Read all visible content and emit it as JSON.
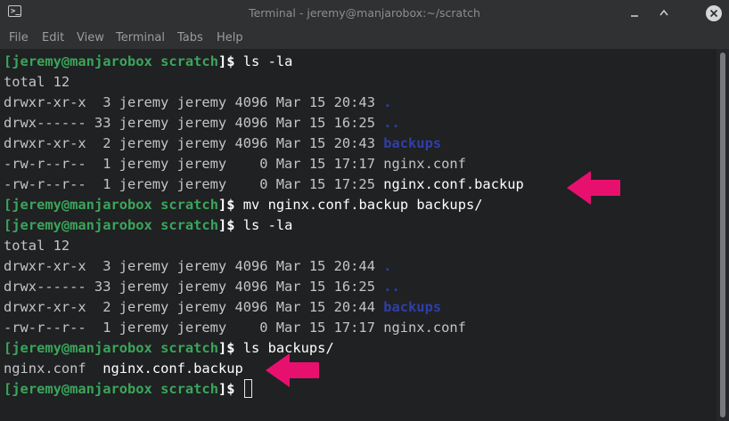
{
  "window": {
    "app_icon": "terminal-icon",
    "title": "Terminal - jeremy@manjarobox:~/scratch",
    "controls": [
      "minimize-icon",
      "maximize-icon",
      "close-icon"
    ]
  },
  "menu": {
    "items": [
      "File",
      "Edit",
      "View",
      "Terminal",
      "Tabs",
      "Help"
    ]
  },
  "prompt": {
    "bracket_open": "[",
    "user_host": "jeremy@manjarobox",
    "dir": "scratch",
    "close": "]$"
  },
  "commands": {
    "ls1": " ls -la",
    "mv": " mv nginx.conf.backup backups/",
    "ls2": " ls -la",
    "ls3": " ls backups/"
  },
  "output": {
    "total1": "total 12",
    "l1_perm": "drwxr-xr-x  3 jeremy jeremy 4096 Mar 15 20:43 ",
    "l1_name": ".",
    "l2_perm": "drwx------ 33 jeremy jeremy 4096 Mar 15 16:25 ",
    "l2_name": "..",
    "l3_perm": "drwxr-xr-x  2 jeremy jeremy 4096 Mar 15 20:43 ",
    "l3_name": "backups",
    "l4_perm": "-rw-r--r--  1 jeremy jeremy    0 Mar 15 17:17 ",
    "l4_name": "nginx.conf",
    "l5_perm": "-rw-r--r--  1 jeremy jeremy    0 Mar 15 17:25 ",
    "l5_name": "nginx.conf.backup",
    "total2": "total 12",
    "m1_perm": "drwxr-xr-x  3 jeremy jeremy 4096 Mar 15 20:44 ",
    "m1_name": ".",
    "m2_perm": "drwx------ 33 jeremy jeremy 4096 Mar 15 16:25 ",
    "m2_name": "..",
    "m3_perm": "drwxr-xr-x  2 jeremy jeremy 4096 Mar 15 20:44 ",
    "m3_name": "backups",
    "m4_perm": "-rw-r--r--  1 jeremy jeremy    0 Mar 15 17:17 ",
    "m4_name": "nginx.conf",
    "b1": "nginx.conf",
    "b_sep": "  ",
    "b2": "nginx.conf.backup"
  },
  "colors": {
    "prompt_green": "#3ba55a",
    "directory_blue": "#2f3fa8",
    "annotation_arrow": "#e8106e",
    "terminal_bg": "#1f2123"
  },
  "annotations": [
    "arrow-icon",
    "arrow-icon"
  ]
}
